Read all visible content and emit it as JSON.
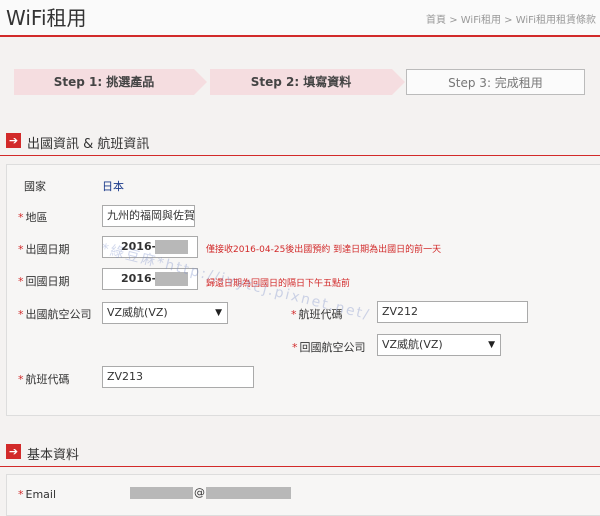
{
  "header": {
    "title": "WiFi租用",
    "breadcrumb": "首頁 > WiFi租用 > WiFi租用租賃條款"
  },
  "steps": [
    {
      "label": "Step 1: 挑選產品",
      "state": "done"
    },
    {
      "label": "Step 2: 填寫資料",
      "state": "current"
    },
    {
      "label": "Step 3: 完成租用",
      "state": "pending"
    }
  ],
  "travel_section": {
    "title": "出國資訊 & 航班資訊",
    "country_label": "國家",
    "country_value": "日本",
    "region_label": "地區",
    "region_value": "九州的福岡與佐賀",
    "depart_date_label": "出國日期",
    "depart_date_value": "2016-",
    "depart_note": "僅接收2016-04-25後出國預約 到達日期為出國日的前一天",
    "return_date_label": "回國日期",
    "return_date_value": "2016-",
    "return_note": "歸還日期為回國日的隔日下午五點前",
    "depart_airline_label": "出國航空公司",
    "depart_airline_value": "VZ威航(VZ)",
    "depart_flight_label": "航班代碼",
    "depart_flight_value": "ZV212",
    "return_airline_label": "回國航空公司",
    "return_airline_value": "VZ威航(VZ)",
    "return_flight_label": "航班代碼",
    "return_flight_value": "ZV213"
  },
  "basic_section": {
    "title": "基本資料",
    "email_label": "Email",
    "email_at": "@"
  },
  "watermark": "*綠豆麻*http://ivytcj.pixnet.net/",
  "colors": {
    "accent": "#d22a2a",
    "step_active": "#f5dde0",
    "link_blue": "#1a3a8a"
  }
}
